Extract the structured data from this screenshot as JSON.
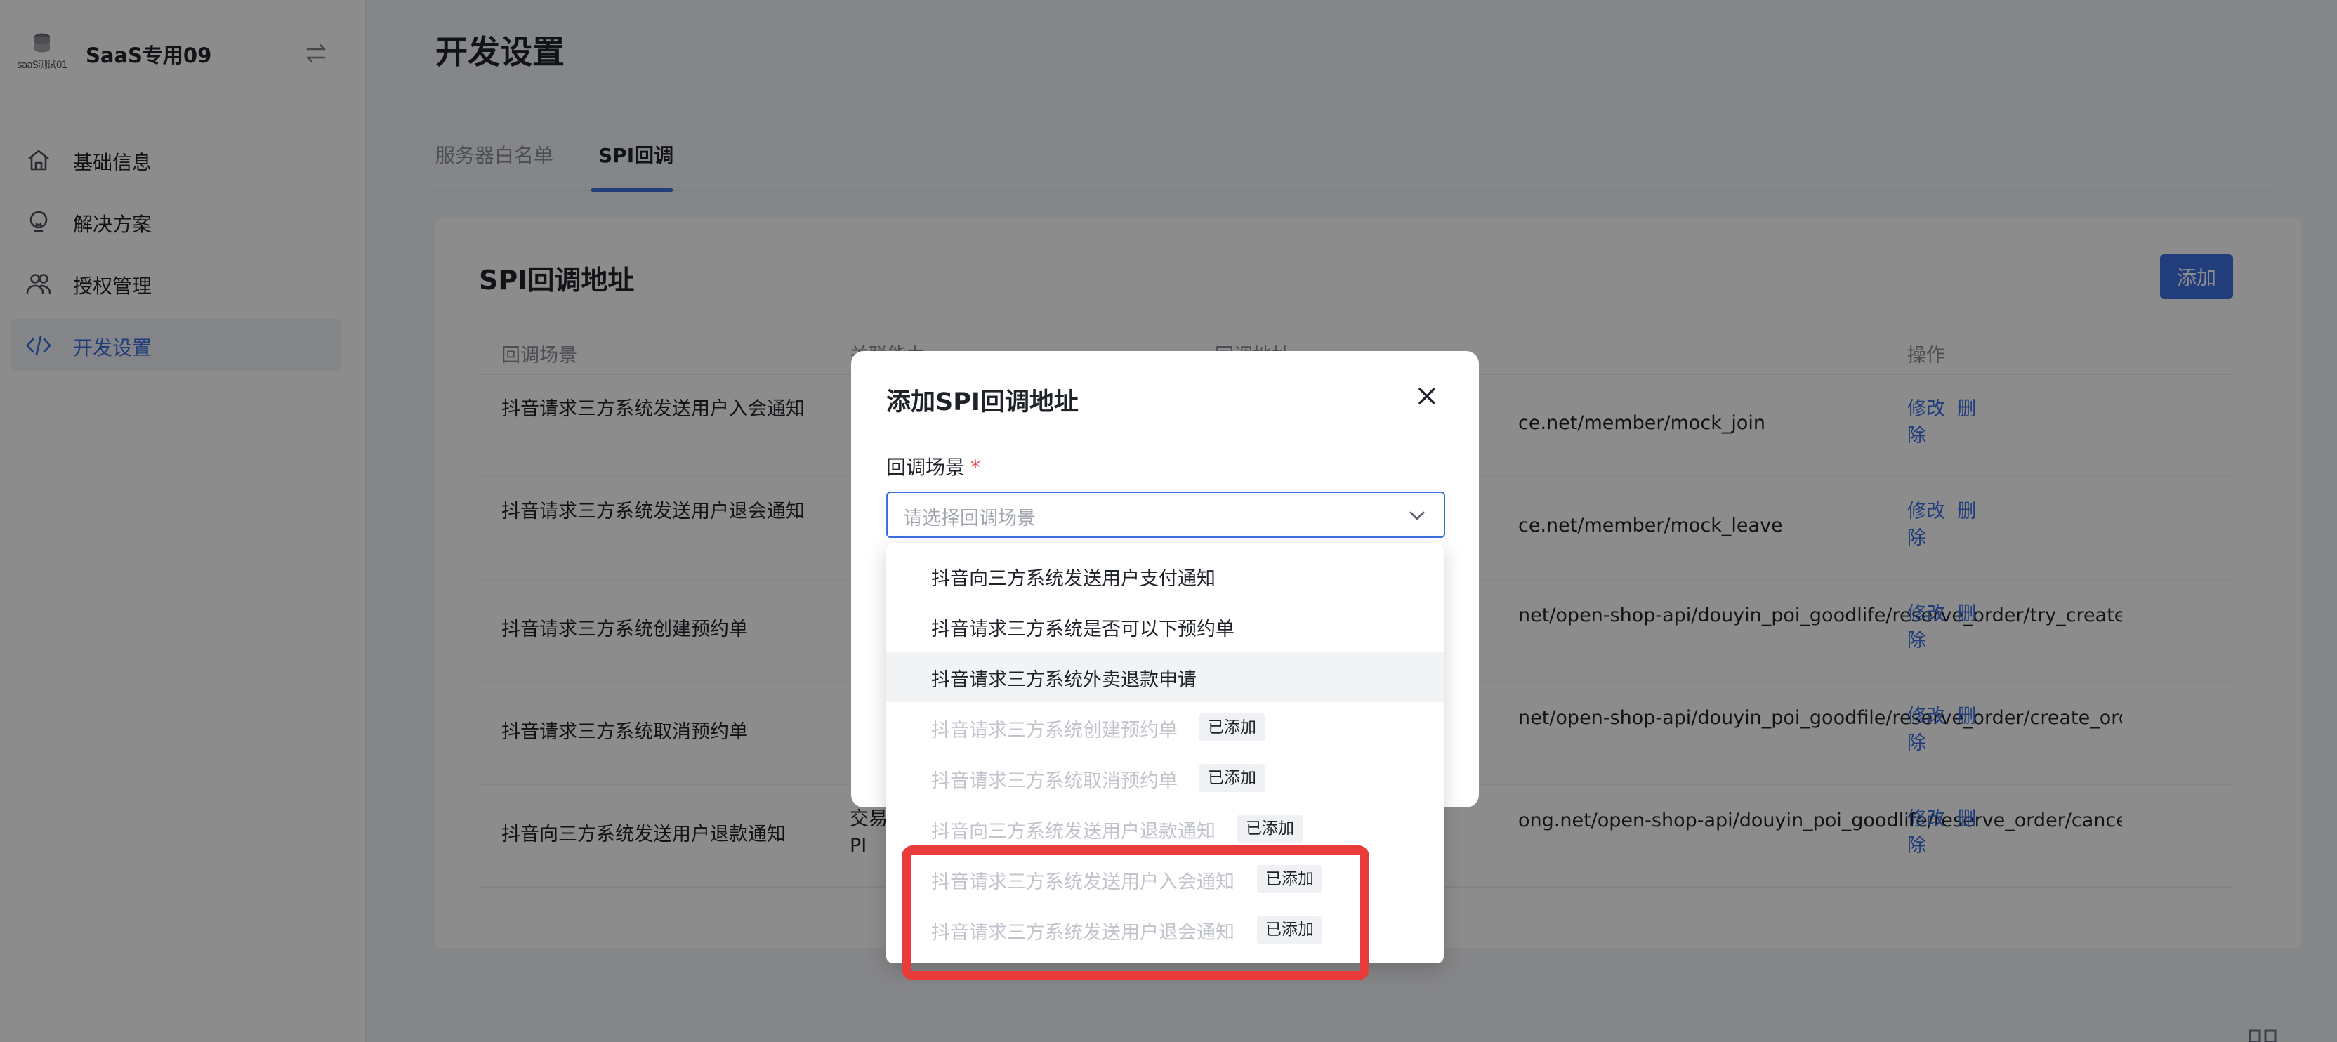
{
  "sidebar": {
    "logo_text": "saaS测试01",
    "brand_name": "SaaS专用09",
    "items": [
      {
        "label": "基础信息",
        "icon": "home-icon"
      },
      {
        "label": "解决方案",
        "icon": "bulb-icon"
      },
      {
        "label": "授权管理",
        "icon": "users-icon"
      },
      {
        "label": "开发设置",
        "icon": "code-icon",
        "active": true
      }
    ]
  },
  "page": {
    "title": "开发设置",
    "tabs": [
      {
        "label": "服务器白名单"
      },
      {
        "label": "SPI回调",
        "active": true
      }
    ]
  },
  "card": {
    "title": "SPI回调地址",
    "add_label": "添加",
    "columns": [
      "回调场景",
      "关联能力",
      "回调地址",
      "操作"
    ],
    "rows": [
      {
        "scene": "抖音请求三方系统发送用户入会通知",
        "capability": "",
        "url": "ce.net/member/mock_join",
        "edit": "修改",
        "del": "删除"
      },
      {
        "scene": "抖音请求三方系统发送用户退会通知",
        "capability": "",
        "url": "ce.net/member/mock_leave",
        "edit": "修改",
        "del": "删除"
      },
      {
        "scene": "抖音请求三方系统创建预约单",
        "capability": "",
        "url": "net/open-shop-api/douyin_poi_goodlife/reserve_order/try_create_o",
        "edit": "修改",
        "del": "删除"
      },
      {
        "scene": "抖音请求三方系统取消预约单",
        "capability": "",
        "url": "net/open-shop-api/douyin_poi_goodfile/reserve_order/create_orde",
        "edit": "修改",
        "del": "删除"
      },
      {
        "scene": "抖音向三方系统发送用户退款通知",
        "capability": "交易\nPI",
        "url": "ong.net/open-shop-api/douyin_poi_goodlife/reserve_order/cancel_orde",
        "edit": "修改",
        "del": "删除"
      }
    ]
  },
  "modal": {
    "title": "添加SPI回调地址",
    "field_label": "回调场景",
    "required_mark": "*",
    "placeholder": "请选择回调场景"
  },
  "dropdown": {
    "options": [
      {
        "label": "抖音向三方系统发送用户支付通知",
        "disabled": false
      },
      {
        "label": "抖音请求三方系统是否可以下预约单",
        "disabled": false
      },
      {
        "label": "抖音请求三方系统外卖退款申请",
        "disabled": false,
        "hover": true
      },
      {
        "label": "抖音请求三方系统创建预约单",
        "disabled": true,
        "tag": "已添加"
      },
      {
        "label": "抖音请求三方系统取消预约单",
        "disabled": true,
        "tag": "已添加"
      },
      {
        "label": "抖音向三方系统发送用户退款通知",
        "disabled": true,
        "tag": "已添加"
      },
      {
        "label": "抖音请求三方系统发送用户入会通知",
        "disabled": true,
        "tag": "已添加"
      },
      {
        "label": "抖音请求三方系统发送用户退会通知",
        "disabled": true,
        "tag": "已添加"
      }
    ]
  },
  "colors": {
    "accent": "#3c6fe0",
    "highlight_box": "#ea3b3b",
    "required": "#e5484d"
  }
}
